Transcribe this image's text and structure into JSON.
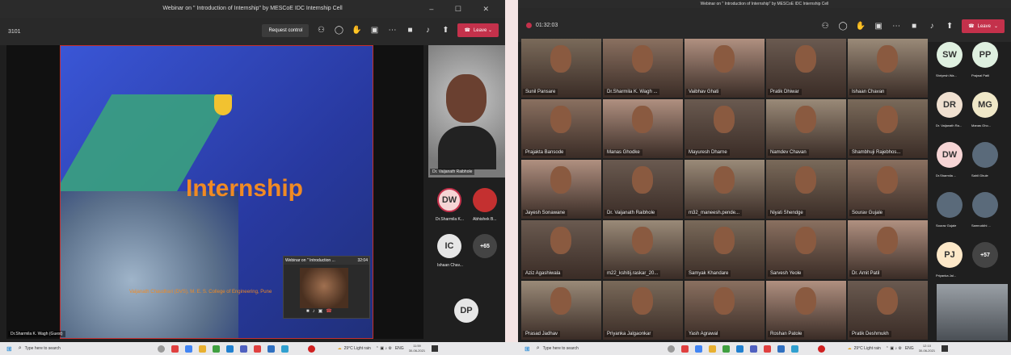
{
  "left_window": {
    "title": "Webinar on \" Introduction of Internship\" by MESCoE IDC Internship Cell",
    "meeting_id": "3101",
    "request_control": "Request control",
    "slide": {
      "title": "Internship",
      "footer": "Vaijanath Chaudhari (DVS), M. E. S. College of Engineering, Pune",
      "pip_name": "Webinar on \" Introduction ...",
      "pip_time": "32:04"
    },
    "presenter_name": "Dr.Sharmila K. Wagh (Guest)",
    "speaker_name": "Dr. Vaijanath Raibhole",
    "participants": [
      {
        "initials": "DW",
        "name": "Dr.Sharmila K..."
      },
      {
        "initials": "",
        "name": "Abhishek B..."
      },
      {
        "initials": "IC",
        "name": "Ishaan Chav..."
      },
      {
        "initials": "+65",
        "name": ""
      },
      {
        "initials": "DP",
        "name": ""
      }
    ]
  },
  "right_window": {
    "title": "Webinar on \" Introduction of Internship\" by MESCoE IDC Internship Cell",
    "timer": "01:32:03",
    "leave": "Leave",
    "grid": [
      [
        "Sunil Pansare",
        "Dr.Sharmila K. Wagh ...",
        "Vaibhav Ghati",
        "Pratik Dhiwar",
        "Ishaan Chavan"
      ],
      [
        "Prajakta Bansode",
        "Manas Ghodke",
        "Mayuresh Dharne",
        "Namdev Chavan",
        "Shambhuji Rajebhos..."
      ],
      [
        "Jayesh Sonawane",
        "Dr. Vaijanath Raibhole",
        "m32_maneesh.pende...",
        "Niyati Shendge",
        "Sourav Gujale"
      ],
      [
        "Aziz Agashiwala",
        "m22_kshitij.raskar_20...",
        "Samyak Khandare",
        "Sarvesh Yeole",
        "Dr. Amit Patil"
      ],
      [
        "Prasad Jadhav",
        "Priyanka Jalgaonkar",
        "Yash Agrawal",
        "Roshan Patole",
        "Pratik Deshmukh"
      ]
    ],
    "side": [
      {
        "initials": "SW",
        "name": "Shriyesh Wa..."
      },
      {
        "initials": "PP",
        "name": "Prajwal Patil"
      },
      {
        "initials": "DR",
        "name": "Dr. Vaijanath Ra..."
      },
      {
        "initials": "MG",
        "name": "Manas Gho..."
      },
      {
        "initials": "DW",
        "name": "Dr.Sharmila ..."
      },
      {
        "initials": "",
        "name": "Sahil Ghule"
      },
      {
        "initials": "",
        "name": "Sourav Gujale"
      },
      {
        "initials": "",
        "name": "Samruddhi ..."
      },
      {
        "initials": "PJ",
        "name": "Priyanka Jal..."
      },
      {
        "initials": "+57",
        "name": ""
      }
    ]
  },
  "taskbar": {
    "left": {
      "search": "Type here to search",
      "weather": "29°C Light rain",
      "lang": "ENG",
      "time": "11:59",
      "date": "30-06-2021"
    },
    "right": {
      "search": "Type here to search",
      "weather": "29°C Light rain",
      "lang": "ENG",
      "time": "12:10",
      "date": "30-06-2021"
    }
  },
  "colors": {
    "leave": "#c4314b",
    "slide_bg": "#2a3fa8",
    "slide_title": "#f08a24"
  }
}
